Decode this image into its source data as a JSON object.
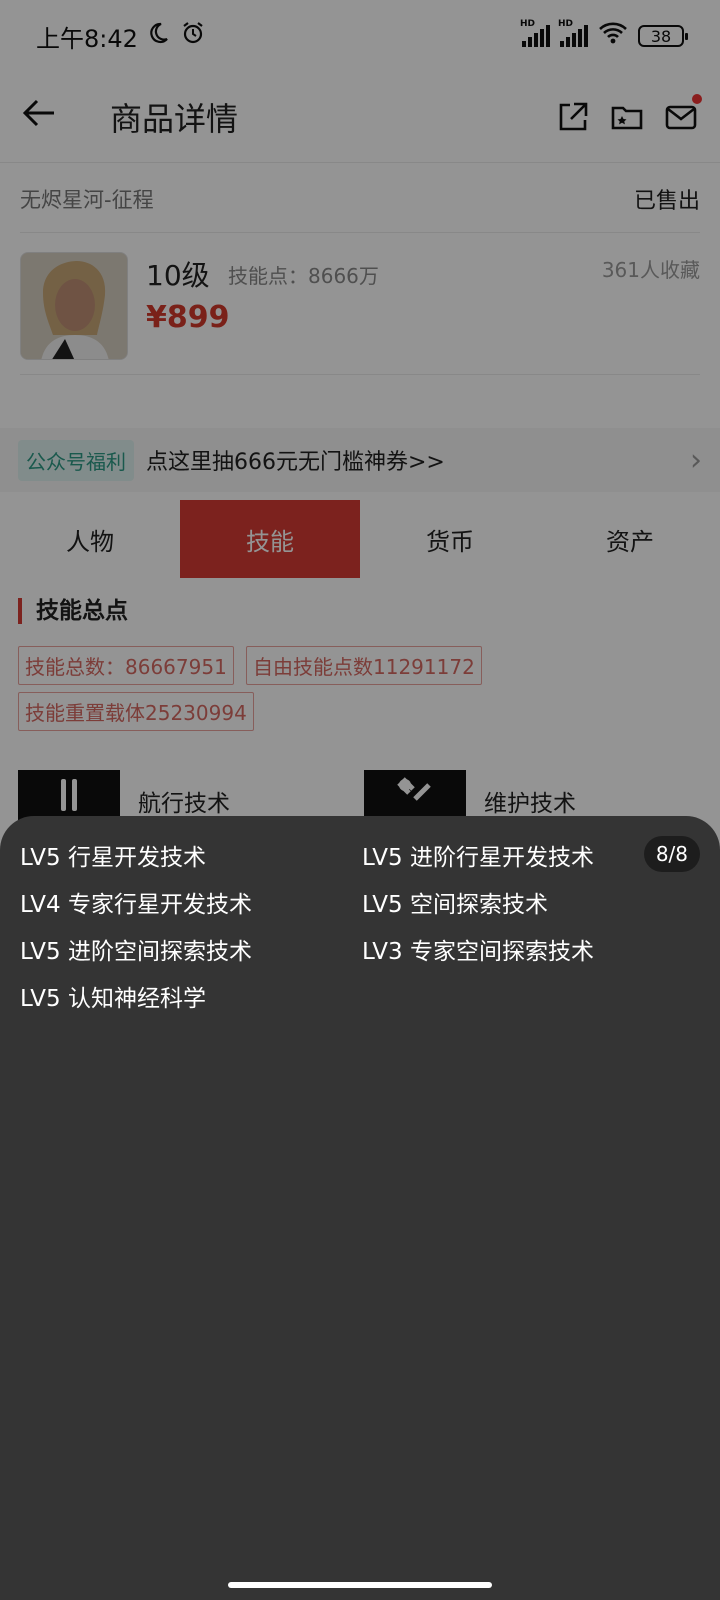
{
  "status_bar": {
    "time": "上午8:42",
    "battery": "38",
    "hd_label": "HD"
  },
  "header": {
    "back_icon": "←",
    "title": "商品详情"
  },
  "product": {
    "game_name": "无烬星河-征程",
    "sale_status": "已售出",
    "level": "10级",
    "skill_points": "技能点：8666万",
    "favorites": "361人收藏",
    "price": "¥899"
  },
  "promo": {
    "tag": "公众号福利",
    "text": "点这里抽666元无门槛神券>>",
    "chevron": "›"
  },
  "tabs": [
    {
      "label": "人物",
      "active": false
    },
    {
      "label": "技能",
      "active": true
    },
    {
      "label": "货币",
      "active": false
    },
    {
      "label": "资产",
      "active": false
    }
  ],
  "skills_section": {
    "title": "技能总点",
    "chips": [
      "技能总数：86667951",
      "自由技能点数11291172",
      "技能重置载体25230994"
    ],
    "categories": [
      {
        "label": "航行技术",
        "icon": "navigation-icon"
      },
      {
        "label": "维护技术",
        "icon": "wrench-icon"
      }
    ]
  },
  "sheet": {
    "counter": "8/8",
    "skills": [
      "LV5 行星开发技术",
      "LV5 进阶行星开发技术",
      "LV4 专家行星开发技术",
      "LV5 空间探索技术",
      "LV5 进阶空间探索技术",
      "LV3 专家空间探索技术",
      "LV5 认知神经科学"
    ]
  },
  "colors": {
    "accent_red": "#d63b34",
    "price_red": "#d23a2c",
    "sheet_bg": "#343434",
    "promo_tag_bg": "#dff2ef",
    "promo_tag_text": "#2d9a86"
  }
}
